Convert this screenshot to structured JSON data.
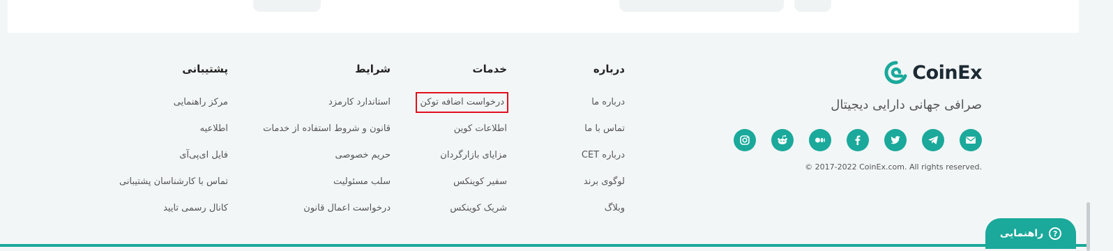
{
  "brand": {
    "name": "CoinEx",
    "tagline": "صرافی جهانی دارایی دیجیتال",
    "copyright": "© 2017-2022 CoinEx.com. All rights reserved."
  },
  "socials": [
    "mail-icon",
    "telegram-icon",
    "twitter-icon",
    "facebook-icon",
    "medium-icon",
    "reddit-icon",
    "instagram-icon"
  ],
  "columns": [
    {
      "title": "درباره",
      "links": [
        "درباره ما",
        "تماس با ما",
        "درباره CET",
        "لوگوی برند",
        "وبلاگ"
      ]
    },
    {
      "title": "خدمات",
      "links": [
        "درخواست اضافه توکن",
        "اطلاعات کوین",
        "مزایای بازارگردان",
        "سفیر کوینکس",
        "شریک کوینکس"
      ]
    },
    {
      "title": "شرایط",
      "links": [
        "استاندارد کارمزد",
        "قانون و شروط استفاده از خدمات",
        "حریم خصوصی",
        "سلب مسئولیت",
        "درخواست اعمال قانون"
      ]
    },
    {
      "title": "پشتیبانی",
      "links": [
        "مرکز راهنمایی",
        "اطلاعیه",
        "فایل ای‌پی‌آی",
        "تماس با کارشناسان پشتیبانی",
        "کانال رسمی تایید"
      ]
    }
  ],
  "help_button": {
    "label": "راهنمایی"
  },
  "colors": {
    "accent": "#1aa99b",
    "highlight": "#e0101e"
  }
}
